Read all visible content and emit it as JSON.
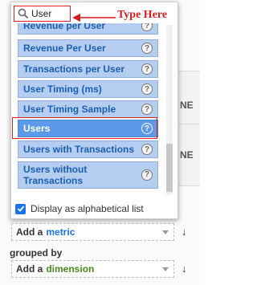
{
  "search": {
    "value": "User",
    "placeholder": ""
  },
  "annotation": {
    "text": "Type Here",
    "color": "#d71a1a"
  },
  "list_items": [
    {
      "label": "Revenue per User",
      "help": "?"
    },
    {
      "label": "Revenue Per User",
      "help": "?"
    },
    {
      "label": "Transactions per User",
      "help": "?"
    },
    {
      "label": "User Timing (ms)",
      "help": "?"
    },
    {
      "label": "User Timing Sample",
      "help": "?"
    },
    {
      "label": "Users",
      "help": "?",
      "selected": true
    },
    {
      "label": "Users with Transactions",
      "help": "?"
    },
    {
      "label": "Users without Transactions",
      "help": "?"
    }
  ],
  "footer": {
    "checkbox_checked": true,
    "label": "Display as alphabetical list"
  },
  "metric_row": {
    "prefix": "Add a",
    "value": "metric",
    "value_color": "#1a73e8",
    "arrow": "↓"
  },
  "grouped_by": {
    "label": "grouped by"
  },
  "dimension_row": {
    "prefix": "Add a",
    "value": "dimension",
    "value_color": "#4a8a1c",
    "arrow": "↓"
  },
  "background": {
    "fragment_1": "NE",
    "fragment_2": "NE"
  },
  "colors": {
    "item_bg": "#b4cdf0",
    "item_selected_bg": "#5a9ae8",
    "highlight": "#e02020"
  }
}
